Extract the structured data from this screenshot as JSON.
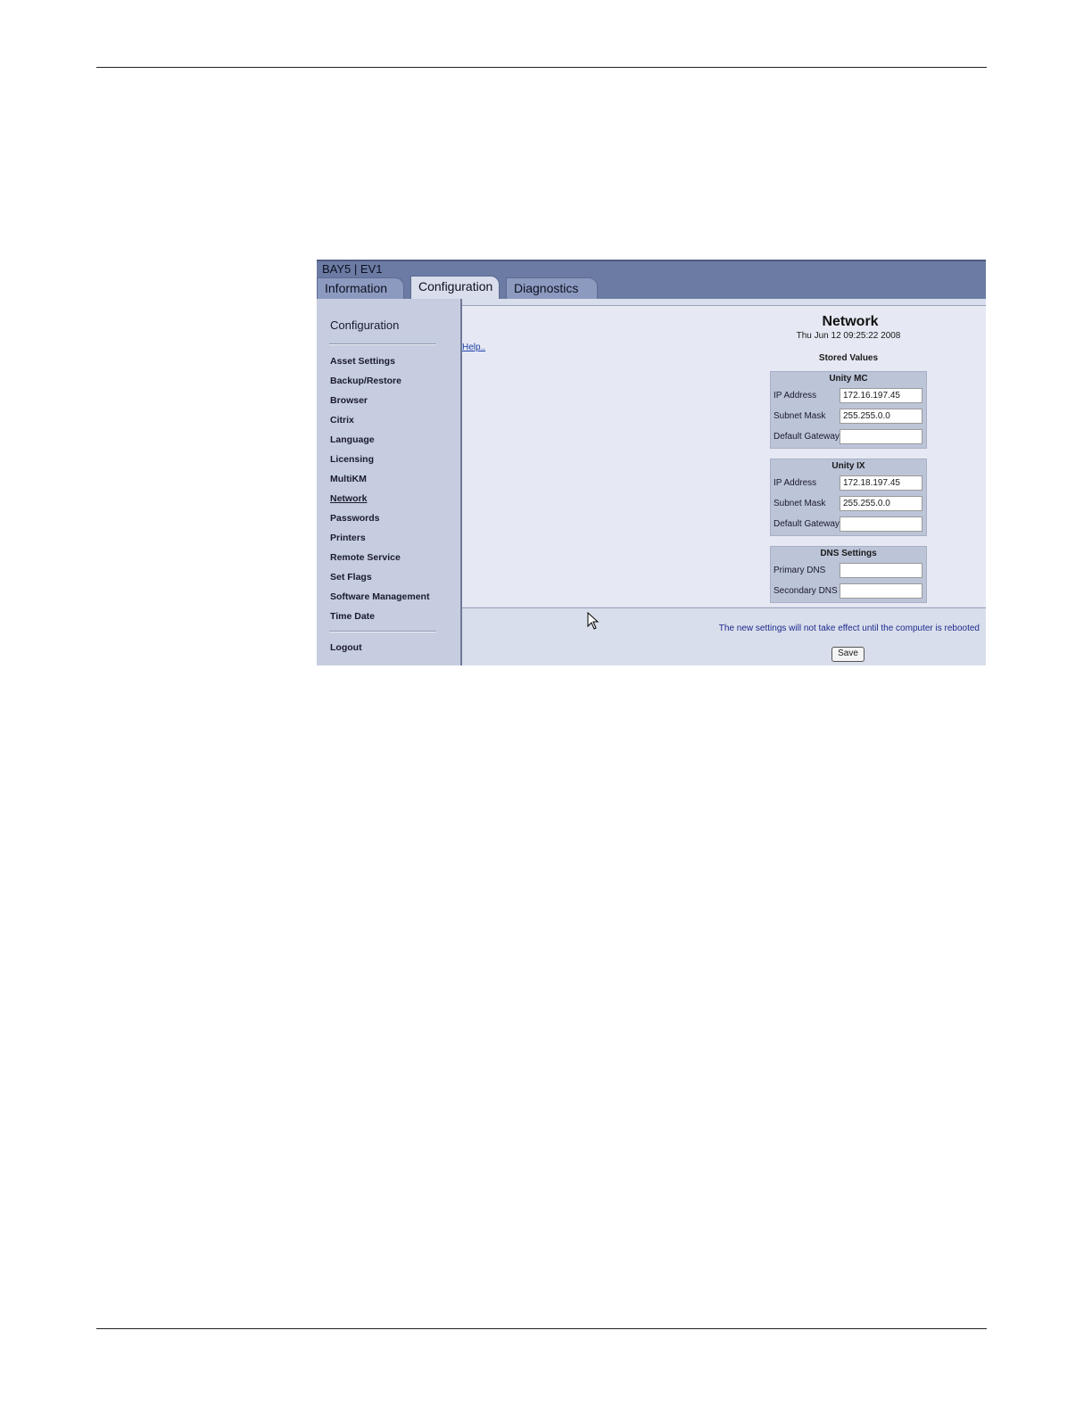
{
  "window": {
    "title": "BAY5 | EV1"
  },
  "tabs": [
    {
      "label": "Information"
    },
    {
      "label": "Configuration",
      "active": true
    },
    {
      "label": "Diagnostics"
    }
  ],
  "sidebar": {
    "title": "Configuration",
    "items": [
      {
        "label": "Asset Settings"
      },
      {
        "label": "Backup/Restore"
      },
      {
        "label": "Browser"
      },
      {
        "label": "Citrix"
      },
      {
        "label": "Language"
      },
      {
        "label": "Licensing"
      },
      {
        "label": "MultiKM"
      },
      {
        "label": "Network",
        "active": true
      },
      {
        "label": "Passwords"
      },
      {
        "label": "Printers"
      },
      {
        "label": "Remote Service"
      },
      {
        "label": "Set Flags"
      },
      {
        "label": "Software Management"
      },
      {
        "label": "Time Date"
      }
    ],
    "logout": "Logout"
  },
  "main": {
    "title": "Network",
    "date": "Thu Jun 12 09:25:22 2008",
    "help": "Help..",
    "stored_values": "Stored Values",
    "groups": [
      {
        "title": "Unity MC",
        "fields": [
          {
            "label": "IP Address",
            "value": "172.16.197.45"
          },
          {
            "label": "Subnet Mask",
            "value": "255.255.0.0"
          },
          {
            "label": "Default Gateway",
            "value": ""
          }
        ]
      },
      {
        "title": "Unity IX",
        "fields": [
          {
            "label": "IP Address",
            "value": "172.18.197.45"
          },
          {
            "label": "Subnet Mask",
            "value": "255.255.0.0"
          },
          {
            "label": "Default Gateway",
            "value": ""
          }
        ]
      },
      {
        "title": "DNS Settings",
        "fields": [
          {
            "label": "Primary DNS",
            "value": ""
          },
          {
            "label": "Secondary DNS",
            "value": ""
          }
        ]
      }
    ],
    "notice": "The new settings will not take effect until the computer is rebooted",
    "save_label": "Save"
  },
  "icons": {
    "cursor": "mouse-pointer-icon"
  }
}
